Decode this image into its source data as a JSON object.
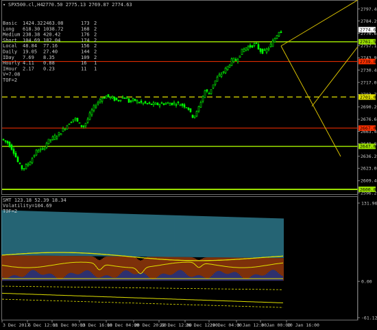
{
  "colors": {
    "background": "#000000",
    "bull": "#00ff00",
    "bear": "#00cc00",
    "yellow_line": "#e0e000",
    "green_line": "#9ae000",
    "red_line": "#ff3000",
    "fan": "#d8c000",
    "hist_blue": "#3ea7c2",
    "hist_orange": "#d05010",
    "navy": "#203080"
  },
  "header": {
    "symbol_label": "SPX500.cl,H4",
    "ohlc": "2770.50 2775.13 2769.87 2774.63"
  },
  "info_table": [
    {
      "label": "Basic",
      "a": "1424.32",
      "b": "2463.08",
      "c": "173",
      "d": "2"
    },
    {
      "label": "Long",
      "a": "618.30",
      "b": "1038.72",
      "c": "168",
      "d": "2"
    },
    {
      "label": "Medium",
      "a": "238.38",
      "b": "420.42",
      "c": "176",
      "d": "2"
    },
    {
      "label": "Short",
      "a": "104.69",
      "b": "182.04",
      "c": "174",
      "d": "2"
    },
    {
      "label": "Local",
      "a": "48.84",
      "b": "77.16",
      "c": "156",
      "d": "2"
    },
    {
      "label": "Daily",
      "a": "19.05",
      "b": "27.40",
      "c": "144",
      "d": "2"
    },
    {
      "label": "IDay",
      "a": "7.69",
      "b": "8.35",
      "c": "109",
      "d": "2"
    },
    {
      "label": "Hourly",
      "a": "4.11",
      "b": "0.88",
      "c": "16",
      "d": "1"
    },
    {
      "label": "IHour",
      "a": "2.17",
      "b": "0.23",
      "c": "11",
      "d": "1"
    }
  ],
  "info_footer": [
    "V=7.08",
    "TOF=2"
  ],
  "price_axis": {
    "labels": [
      "2797.40",
      "2784.20",
      "2770.63",
      "2757.10",
      "2743.95",
      "2730.48",
      "2717.00",
      "2703.75",
      "2690.20",
      "2676.60",
      "2663.40",
      "2649.80",
      "2636.20",
      "2623.00",
      "2609.40",
      "2596.20"
    ],
    "tags": [
      {
        "value": "2774.63",
        "color": "#ffffff",
        "kind": "current"
      },
      {
        "value": "2761.50",
        "color": "#9ae000",
        "kind": "level"
      },
      {
        "value": "2739.88",
        "color": "#ff3000",
        "kind": "level"
      },
      {
        "value": "2701.00",
        "color": "#e0e000",
        "kind": "level"
      },
      {
        "value": "2667.00",
        "color": "#ff3000",
        "kind": "level"
      },
      {
        "value": "2647.00",
        "color": "#9ae000",
        "kind": "level"
      },
      {
        "value": "2600.00",
        "color": "#9ae000",
        "kind": "level"
      }
    ]
  },
  "indicator": {
    "title": "SMT 123.18 52.39 18.34",
    "line2": "Volatility=104.69",
    "line3": "TOF=2",
    "axis_labels": [
      "131.96",
      "0.00",
      "-61.12"
    ]
  },
  "time_axis": [
    "3 Dec 2017",
    "6 Dec 12:00",
    "11 Dec 00:00",
    "13 Dec 16:00",
    "18 Dec 04:00",
    "20 Dec 20:00",
    "22 Dec 12:00",
    "26 Dec 12:00",
    "29 Dec 04:00",
    "3 Jan 12:00",
    "8 Jan 00:00",
    "10 Jan 16:00"
  ]
}
